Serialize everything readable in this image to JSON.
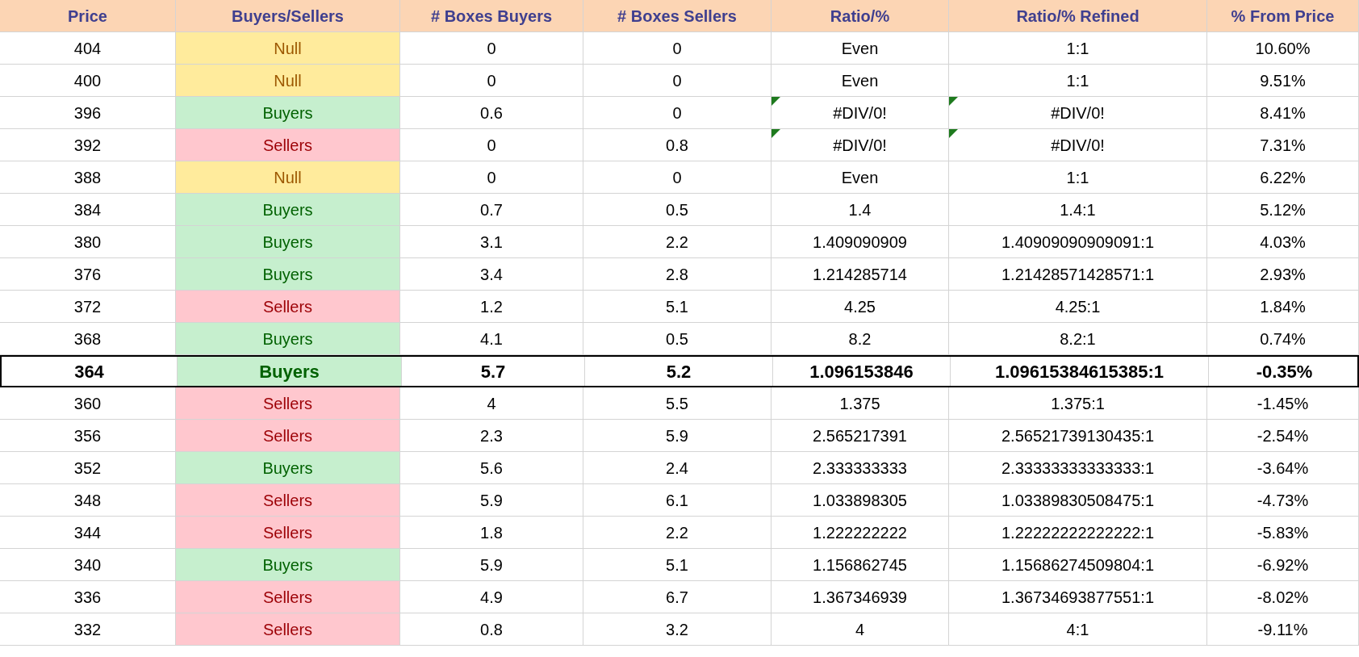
{
  "table": {
    "columns": [
      "Price",
      "Buyers/Sellers",
      "# Boxes Buyers",
      "# Boxes Sellers",
      "Ratio/%",
      "Ratio/% Refined",
      "% From Price"
    ],
    "rows": [
      {
        "price": "404",
        "side": "Null",
        "kind": "null",
        "buyers": "0",
        "sellers": "0",
        "ratio": "Even",
        "ratio_flag": false,
        "refined": "1:1",
        "refined_flag": false,
        "from_price": "10.60%",
        "current": false
      },
      {
        "price": "400",
        "side": "Null",
        "kind": "null",
        "buyers": "0",
        "sellers": "0",
        "ratio": "Even",
        "ratio_flag": false,
        "refined": "1:1",
        "refined_flag": false,
        "from_price": "9.51%",
        "current": false
      },
      {
        "price": "396",
        "side": "Buyers",
        "kind": "buyers",
        "buyers": "0.6",
        "sellers": "0",
        "ratio": "#DIV/0!",
        "ratio_flag": true,
        "refined": "#DIV/0!",
        "refined_flag": true,
        "from_price": "8.41%",
        "current": false
      },
      {
        "price": "392",
        "side": "Sellers",
        "kind": "sellers",
        "buyers": "0",
        "sellers": "0.8",
        "ratio": "#DIV/0!",
        "ratio_flag": true,
        "refined": "#DIV/0!",
        "refined_flag": true,
        "from_price": "7.31%",
        "current": false
      },
      {
        "price": "388",
        "side": "Null",
        "kind": "null",
        "buyers": "0",
        "sellers": "0",
        "ratio": "Even",
        "ratio_flag": false,
        "refined": "1:1",
        "refined_flag": false,
        "from_price": "6.22%",
        "current": false
      },
      {
        "price": "384",
        "side": "Buyers",
        "kind": "buyers",
        "buyers": "0.7",
        "sellers": "0.5",
        "ratio": "1.4",
        "ratio_flag": false,
        "refined": "1.4:1",
        "refined_flag": false,
        "from_price": "5.12%",
        "current": false
      },
      {
        "price": "380",
        "side": "Buyers",
        "kind": "buyers",
        "buyers": "3.1",
        "sellers": "2.2",
        "ratio": "1.409090909",
        "ratio_flag": false,
        "refined": "1.40909090909091:1",
        "refined_flag": false,
        "from_price": "4.03%",
        "current": false
      },
      {
        "price": "376",
        "side": "Buyers",
        "kind": "buyers",
        "buyers": "3.4",
        "sellers": "2.8",
        "ratio": "1.214285714",
        "ratio_flag": false,
        "refined": "1.21428571428571:1",
        "refined_flag": false,
        "from_price": "2.93%",
        "current": false
      },
      {
        "price": "372",
        "side": "Sellers",
        "kind": "sellers",
        "buyers": "1.2",
        "sellers": "5.1",
        "ratio": "4.25",
        "ratio_flag": false,
        "refined": "4.25:1",
        "refined_flag": false,
        "from_price": "1.84%",
        "current": false
      },
      {
        "price": "368",
        "side": "Buyers",
        "kind": "buyers",
        "buyers": "4.1",
        "sellers": "0.5",
        "ratio": "8.2",
        "ratio_flag": false,
        "refined": "8.2:1",
        "refined_flag": false,
        "from_price": "0.74%",
        "current": false
      },
      {
        "price": "364",
        "side": "Buyers",
        "kind": "buyers",
        "buyers": "5.7",
        "sellers": "5.2",
        "ratio": "1.096153846",
        "ratio_flag": false,
        "refined": "1.09615384615385:1",
        "refined_flag": false,
        "from_price": "-0.35%",
        "current": true
      },
      {
        "price": "360",
        "side": "Sellers",
        "kind": "sellers",
        "buyers": "4",
        "sellers": "5.5",
        "ratio": "1.375",
        "ratio_flag": false,
        "refined": "1.375:1",
        "refined_flag": false,
        "from_price": "-1.45%",
        "current": false
      },
      {
        "price": "356",
        "side": "Sellers",
        "kind": "sellers",
        "buyers": "2.3",
        "sellers": "5.9",
        "ratio": "2.565217391",
        "ratio_flag": false,
        "refined": "2.56521739130435:1",
        "refined_flag": false,
        "from_price": "-2.54%",
        "current": false
      },
      {
        "price": "352",
        "side": "Buyers",
        "kind": "buyers",
        "buyers": "5.6",
        "sellers": "2.4",
        "ratio": "2.333333333",
        "ratio_flag": false,
        "refined": "2.33333333333333:1",
        "refined_flag": false,
        "from_price": "-3.64%",
        "current": false
      },
      {
        "price": "348",
        "side": "Sellers",
        "kind": "sellers",
        "buyers": "5.9",
        "sellers": "6.1",
        "ratio": "1.033898305",
        "ratio_flag": false,
        "refined": "1.03389830508475:1",
        "refined_flag": false,
        "from_price": "-4.73%",
        "current": false
      },
      {
        "price": "344",
        "side": "Sellers",
        "kind": "sellers",
        "buyers": "1.8",
        "sellers": "2.2",
        "ratio": "1.222222222",
        "ratio_flag": false,
        "refined": "1.22222222222222:1",
        "refined_flag": false,
        "from_price": "-5.83%",
        "current": false
      },
      {
        "price": "340",
        "side": "Buyers",
        "kind": "buyers",
        "buyers": "5.9",
        "sellers": "5.1",
        "ratio": "1.156862745",
        "ratio_flag": false,
        "refined": "1.15686274509804:1",
        "refined_flag": false,
        "from_price": "-6.92%",
        "current": false
      },
      {
        "price": "336",
        "side": "Sellers",
        "kind": "sellers",
        "buyers": "4.9",
        "sellers": "6.7",
        "ratio": "1.367346939",
        "ratio_flag": false,
        "refined": "1.36734693877551:1",
        "refined_flag": false,
        "from_price": "-8.02%",
        "current": false
      },
      {
        "price": "332",
        "side": "Sellers",
        "kind": "sellers",
        "buyers": "0.8",
        "sellers": "3.2",
        "ratio": "4",
        "ratio_flag": false,
        "refined": "4:1",
        "refined_flag": false,
        "from_price": "-9.11%",
        "current": false
      }
    ]
  }
}
